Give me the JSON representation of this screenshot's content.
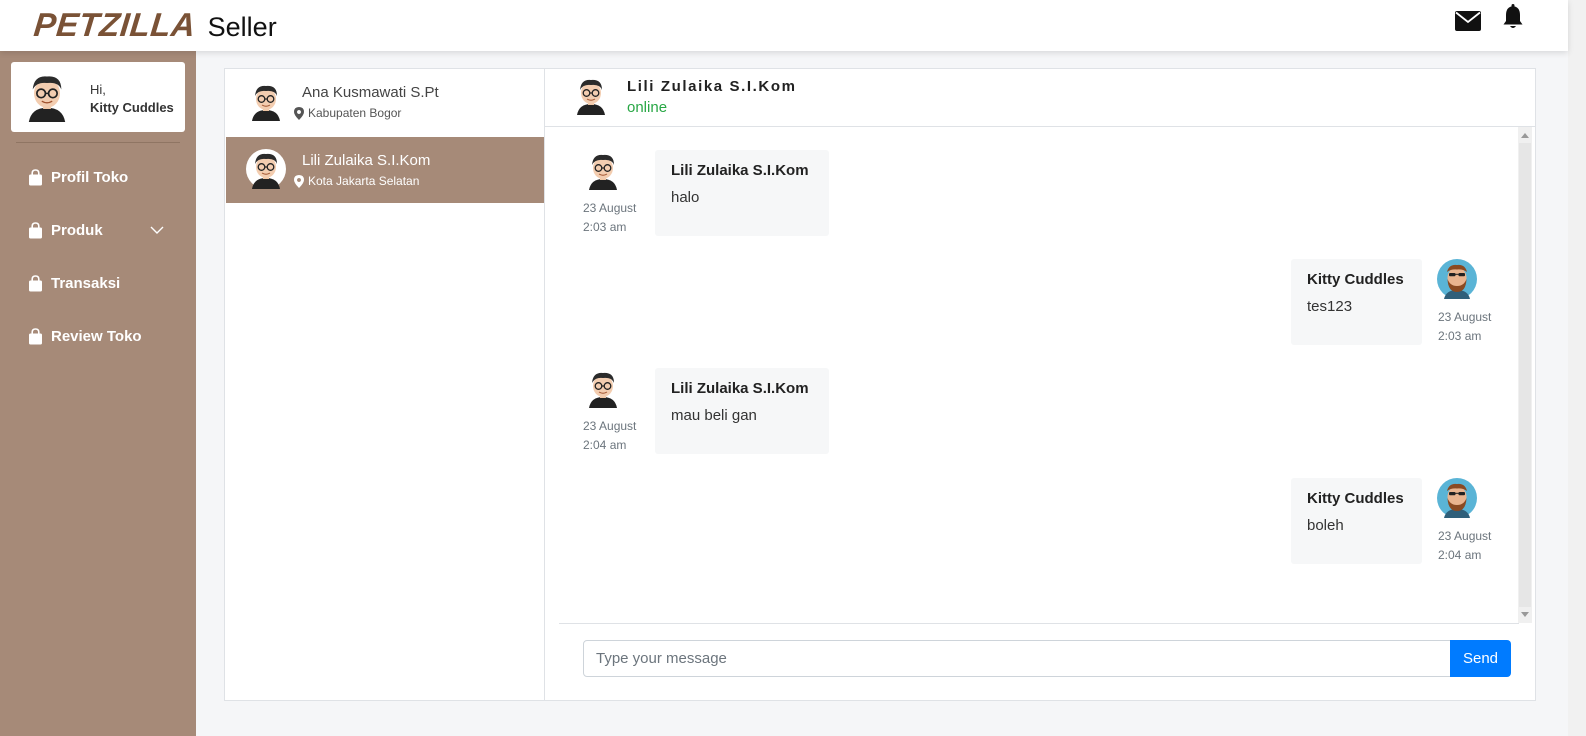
{
  "header": {
    "brand": "PETZILLA",
    "brand_suffix": "Seller",
    "icons": [
      "envelope-icon",
      "bell-icon"
    ]
  },
  "sidebar": {
    "greeting": "Hi,",
    "user_name": "Kitty Cuddles",
    "items": [
      {
        "label": "Profil Toko",
        "icon": "shopping-bag-icon"
      },
      {
        "label": "Produk",
        "icon": "shopping-bag-icon",
        "has_dropdown": true
      },
      {
        "label": "Transaksi",
        "icon": "shopping-bag-icon"
      },
      {
        "label": "Review Toko",
        "icon": "shopping-bag-icon"
      }
    ]
  },
  "contacts": [
    {
      "name": "Ana Kusmawati S.Pt",
      "location": "Kabupaten Bogor",
      "active": false
    },
    {
      "name": "Lili Zulaika S.I.Kom",
      "location": "Kota Jakarta Selatan",
      "active": true
    }
  ],
  "conversation": {
    "name": "Lili Zulaika S.I.Kom",
    "status": "online",
    "messages": [
      {
        "sender": "Lili Zulaika S.I.Kom",
        "text": "halo",
        "date": "23 August",
        "time": "2:03 am",
        "side": "left"
      },
      {
        "sender": "Kitty Cuddles",
        "text": "tes123",
        "date": "23 August",
        "time": "2:03 am",
        "side": "right"
      },
      {
        "sender": "Lili Zulaika S.I.Kom",
        "text": "mau beli gan",
        "date": "23 August",
        "time": "2:04 am",
        "side": "left"
      },
      {
        "sender": "Kitty Cuddles",
        "text": "boleh",
        "date": "23 August",
        "time": "2:04 am",
        "side": "right"
      }
    ]
  },
  "composer": {
    "placeholder": "Type your message",
    "value": "",
    "send_label": "Send"
  },
  "colors": {
    "brand": "#7a5236",
    "sidebar": "#a68a78",
    "online": "#28a745",
    "send": "#007bff"
  }
}
